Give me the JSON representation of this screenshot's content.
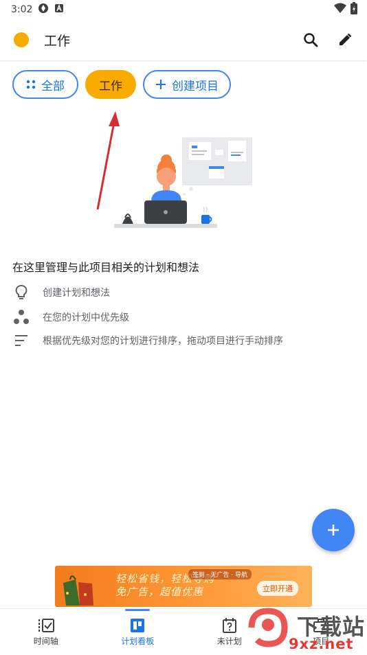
{
  "status": {
    "time": "3:02"
  },
  "app": {
    "title": "工作",
    "dot_color": "#f9ab00"
  },
  "filters": [
    {
      "label": "全部"
    },
    {
      "label": "工作",
      "selected": true
    },
    {
      "label": "创建项目"
    }
  ],
  "empty_state": {
    "title": "在这里管理与此项目相关的计划和想法",
    "tips": [
      {
        "icon": "lightbulb-icon",
        "text": "创建计划和想法"
      },
      {
        "icon": "priority-dots-icon",
        "text": "在您的计划中优先级"
      },
      {
        "icon": "sort-lines-icon",
        "text": "根据优先级对您的计划进行排序，拖动项目进行手动排序"
      }
    ]
  },
  "ad": {
    "slogan_line1": "轻松省钱，轻松导购",
    "slogan_line2": "免广告，超值优惠",
    "tags": "签到 · 无广告 · 导航",
    "cta": "立即开通"
  },
  "bottom_nav": [
    {
      "label": "时间轴"
    },
    {
      "label": "计划看板",
      "active": true
    },
    {
      "label": "未计划"
    },
    {
      "label": "项目"
    }
  ],
  "watermark": {
    "brand": "下载站",
    "domain": "9xz.net"
  },
  "colors": {
    "accent": "#4285f4",
    "chip_selected": "#f9ab00",
    "arrow": "#d32f2f"
  }
}
